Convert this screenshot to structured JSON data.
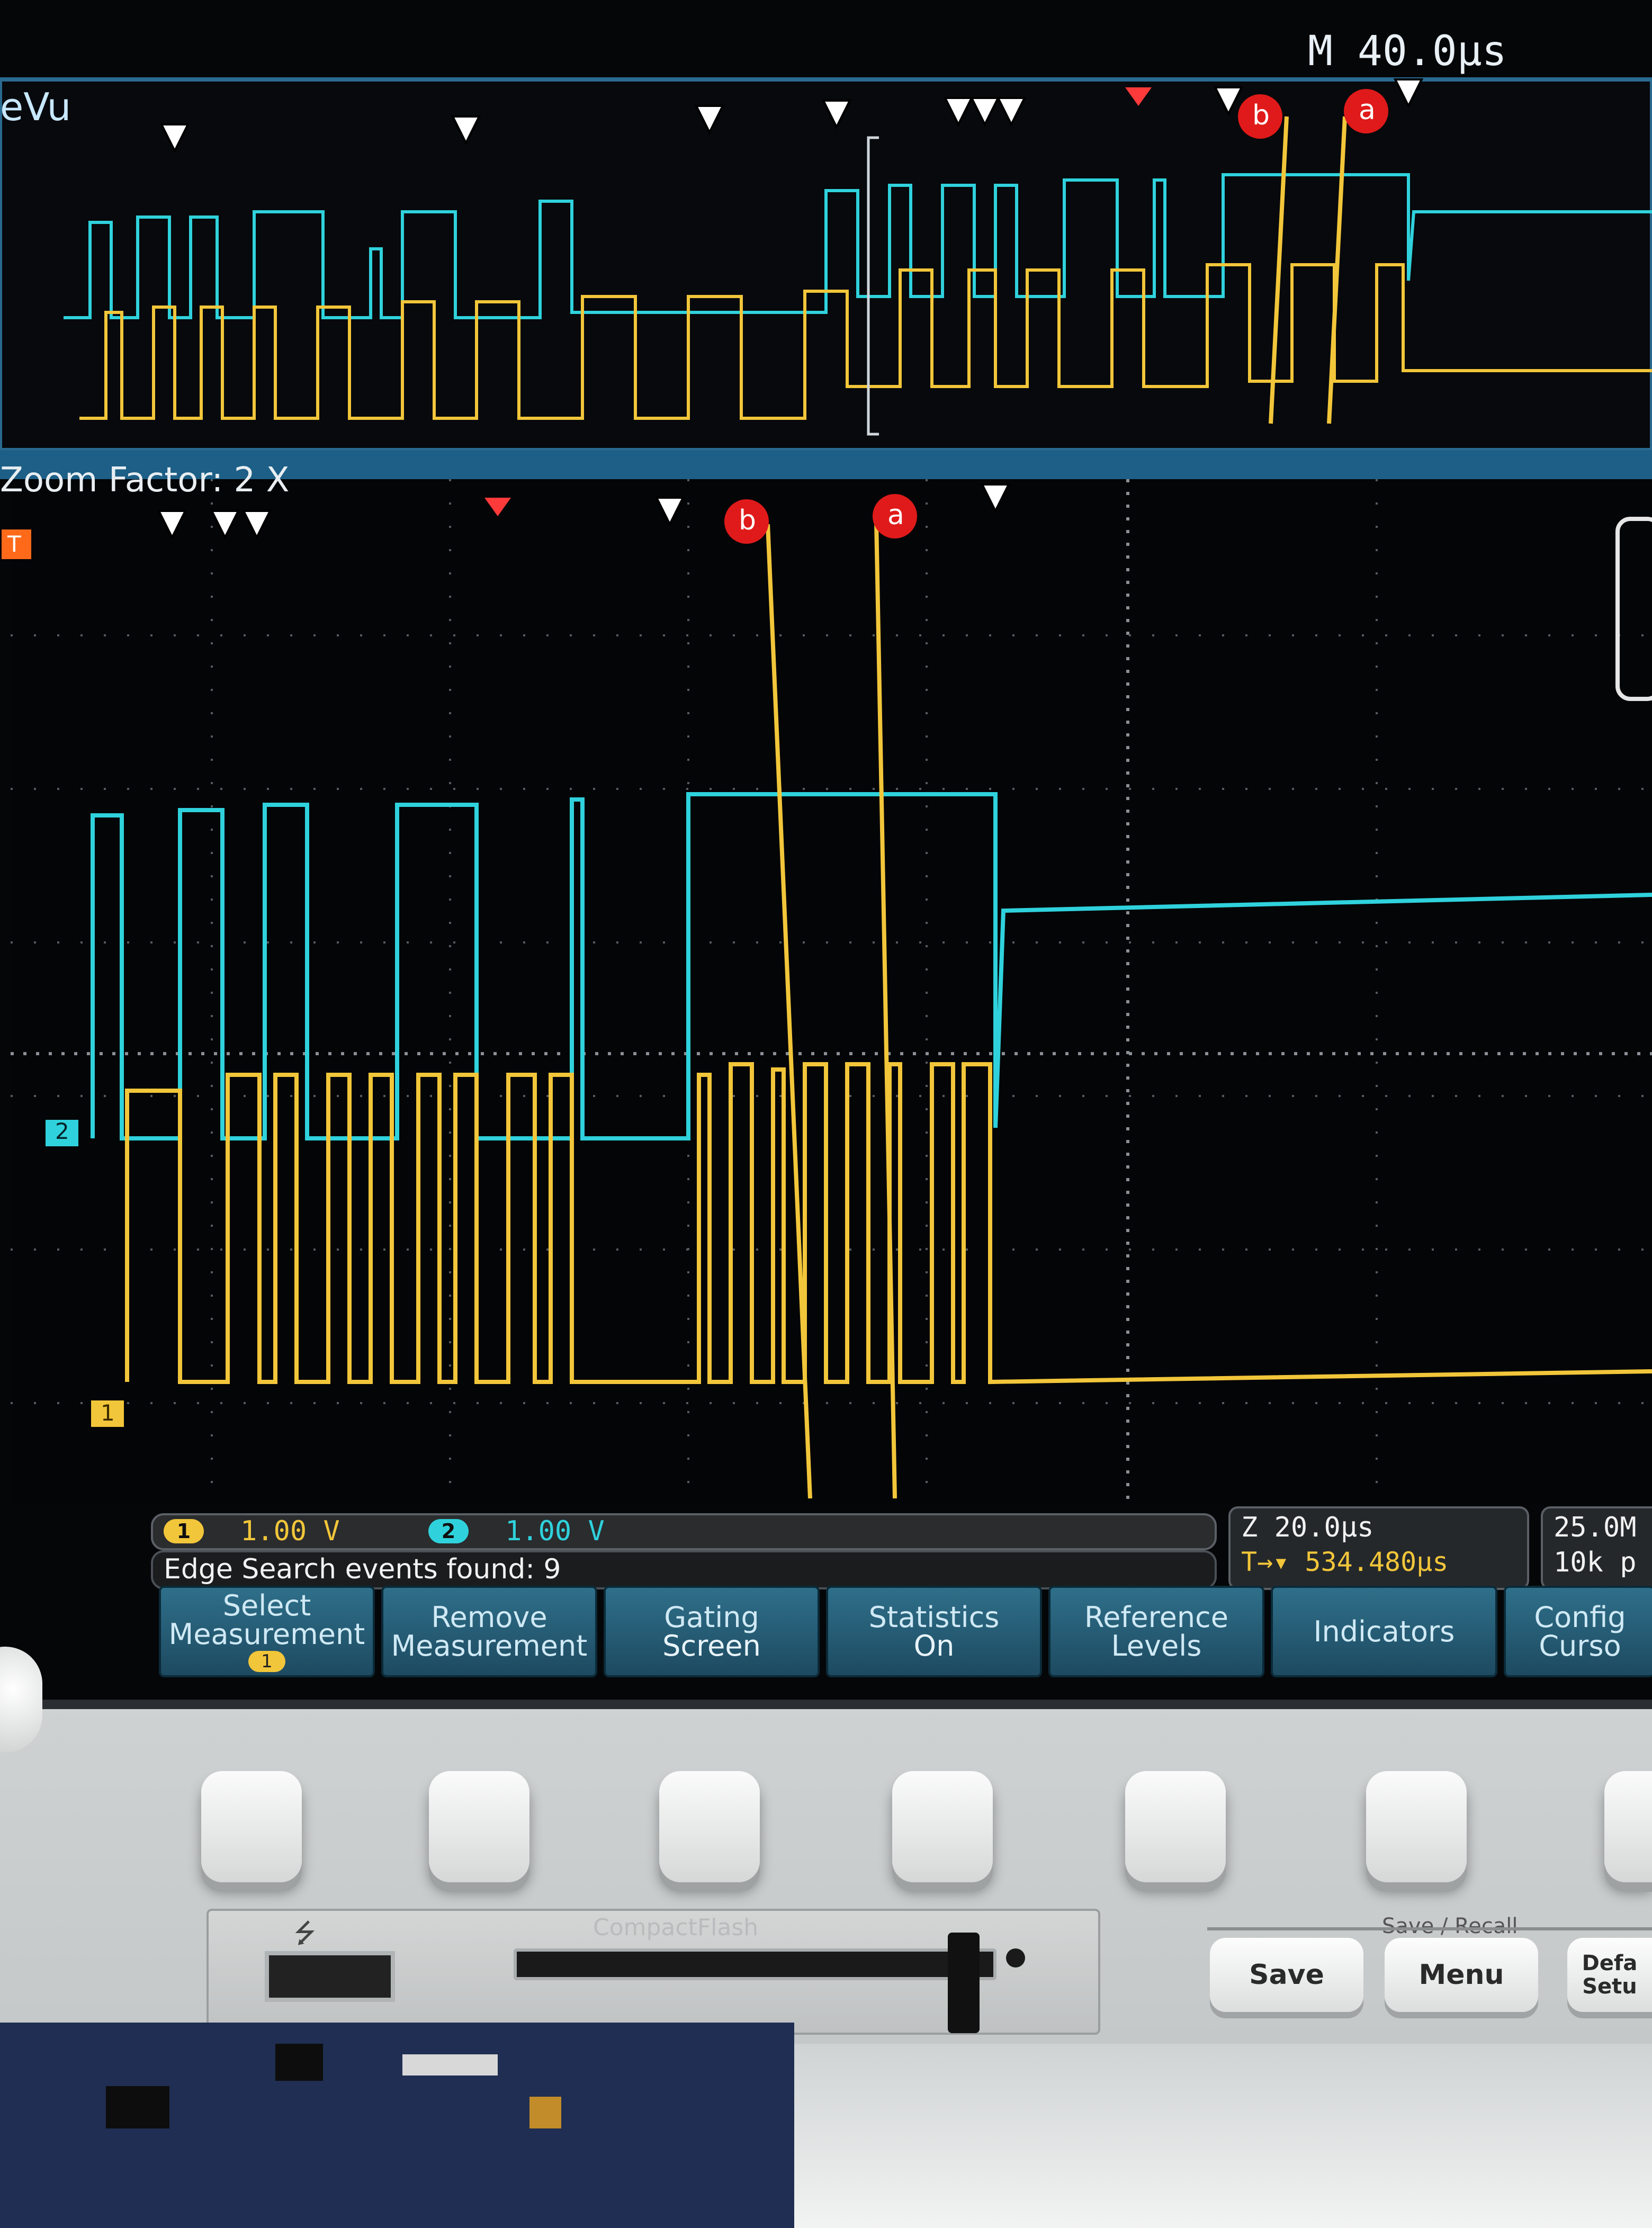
{
  "display": {
    "timebase": "M 40.0μs",
    "wavevu_label": "eVu",
    "zoom_label": "Zoom Factor: 2 X",
    "trigger_marker": "T",
    "channel2_marker": "2",
    "channel1_marker": "1",
    "cursor_a": "a",
    "cursor_b": "b"
  },
  "readouts": {
    "ch1_badge": "1",
    "ch1_scale": "1.00 V",
    "ch2_badge": "2",
    "ch2_scale": "1.00 V",
    "zoom_scale": "Z 20.0μs",
    "trigger_offset": "T→▾ 534.480μs",
    "sample_rate": "25.0M",
    "record_length": "10k p",
    "events": "Edge Search events found: 9"
  },
  "menu": [
    {
      "label": "Select\nMeasurement",
      "badge": "1"
    },
    {
      "label": "Remove\nMeasurement",
      "sub": ""
    },
    {
      "label": "Gating",
      "sub": "Screen"
    },
    {
      "label": "Statistics",
      "sub": "On"
    },
    {
      "label": "Reference\nLevels",
      "sub": ""
    },
    {
      "label": "Indicators",
      "sub": ""
    },
    {
      "label": "Config\nCurso",
      "sub": ""
    }
  ],
  "front_panel": {
    "compactflash": "CompactFlash",
    "save_recall": "Save / Recall",
    "save_btn": "Save",
    "menu_btn": "Menu",
    "default_btn": "Defa\nSetu"
  },
  "colors": {
    "ch1": "#f2c63a",
    "ch2": "#2fd2dc",
    "menu": "#2a6682"
  }
}
